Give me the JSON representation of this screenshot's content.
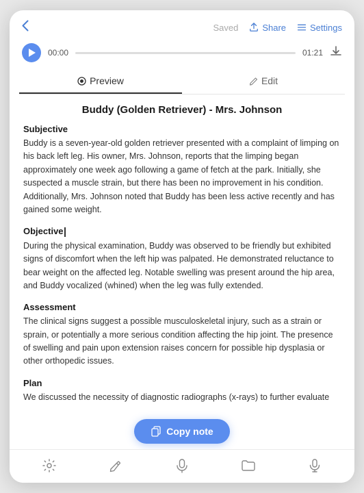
{
  "header": {
    "back_label": "‹",
    "saved_label": "Saved",
    "share_label": "Share",
    "settings_label": "Settings"
  },
  "audio": {
    "time_start": "00:00",
    "time_end": "01:21"
  },
  "tabs": [
    {
      "id": "preview",
      "label": "Preview",
      "active": true
    },
    {
      "id": "edit",
      "label": "Edit",
      "active": false
    }
  ],
  "document": {
    "title": "Buddy (Golden Retriever) - Mrs. Johnson",
    "sections": [
      {
        "heading": "Subjective",
        "body": "Buddy is a seven-year-old golden retriever presented with a complaint of limping on his back left leg. His owner, Mrs. Johnson, reports that the limping began approximately one week ago following a game of fetch at the park. Initially, she suspected a muscle strain, but there has been no improvement in his condition. Additionally, Mrs. Johnson noted that Buddy has been less active recently and has gained some weight."
      },
      {
        "heading": "Objective",
        "body": "During the physical examination, Buddy was observed to be friendly but exhibited signs of discomfort when the left hip was palpated. He demonstrated reluctance to bear weight on the affected leg. Notable swelling was present around the hip area, and Buddy vocalized (whined) when the leg was fully extended."
      },
      {
        "heading": "Assessment",
        "body": "The clinical signs suggest a possible musculoskeletal injury, such as a strain or sprain, or potentially a more serious condition affecting the hip joint. The presence of swelling and pain upon extension raises concern for possible hip dysplasia or other orthopedic issues."
      },
      {
        "heading": "Plan",
        "body": "We discussed the necessity of diagnostic radiographs (x-rays) to further evaluate"
      }
    ]
  },
  "copy_note": {
    "label": "Copy note"
  },
  "bottom_nav": [
    {
      "id": "settings",
      "icon": "gear"
    },
    {
      "id": "edit",
      "icon": "pencil"
    },
    {
      "id": "mic",
      "icon": "mic"
    },
    {
      "id": "folder",
      "icon": "folder"
    },
    {
      "id": "microphone",
      "icon": "microphone"
    }
  ]
}
